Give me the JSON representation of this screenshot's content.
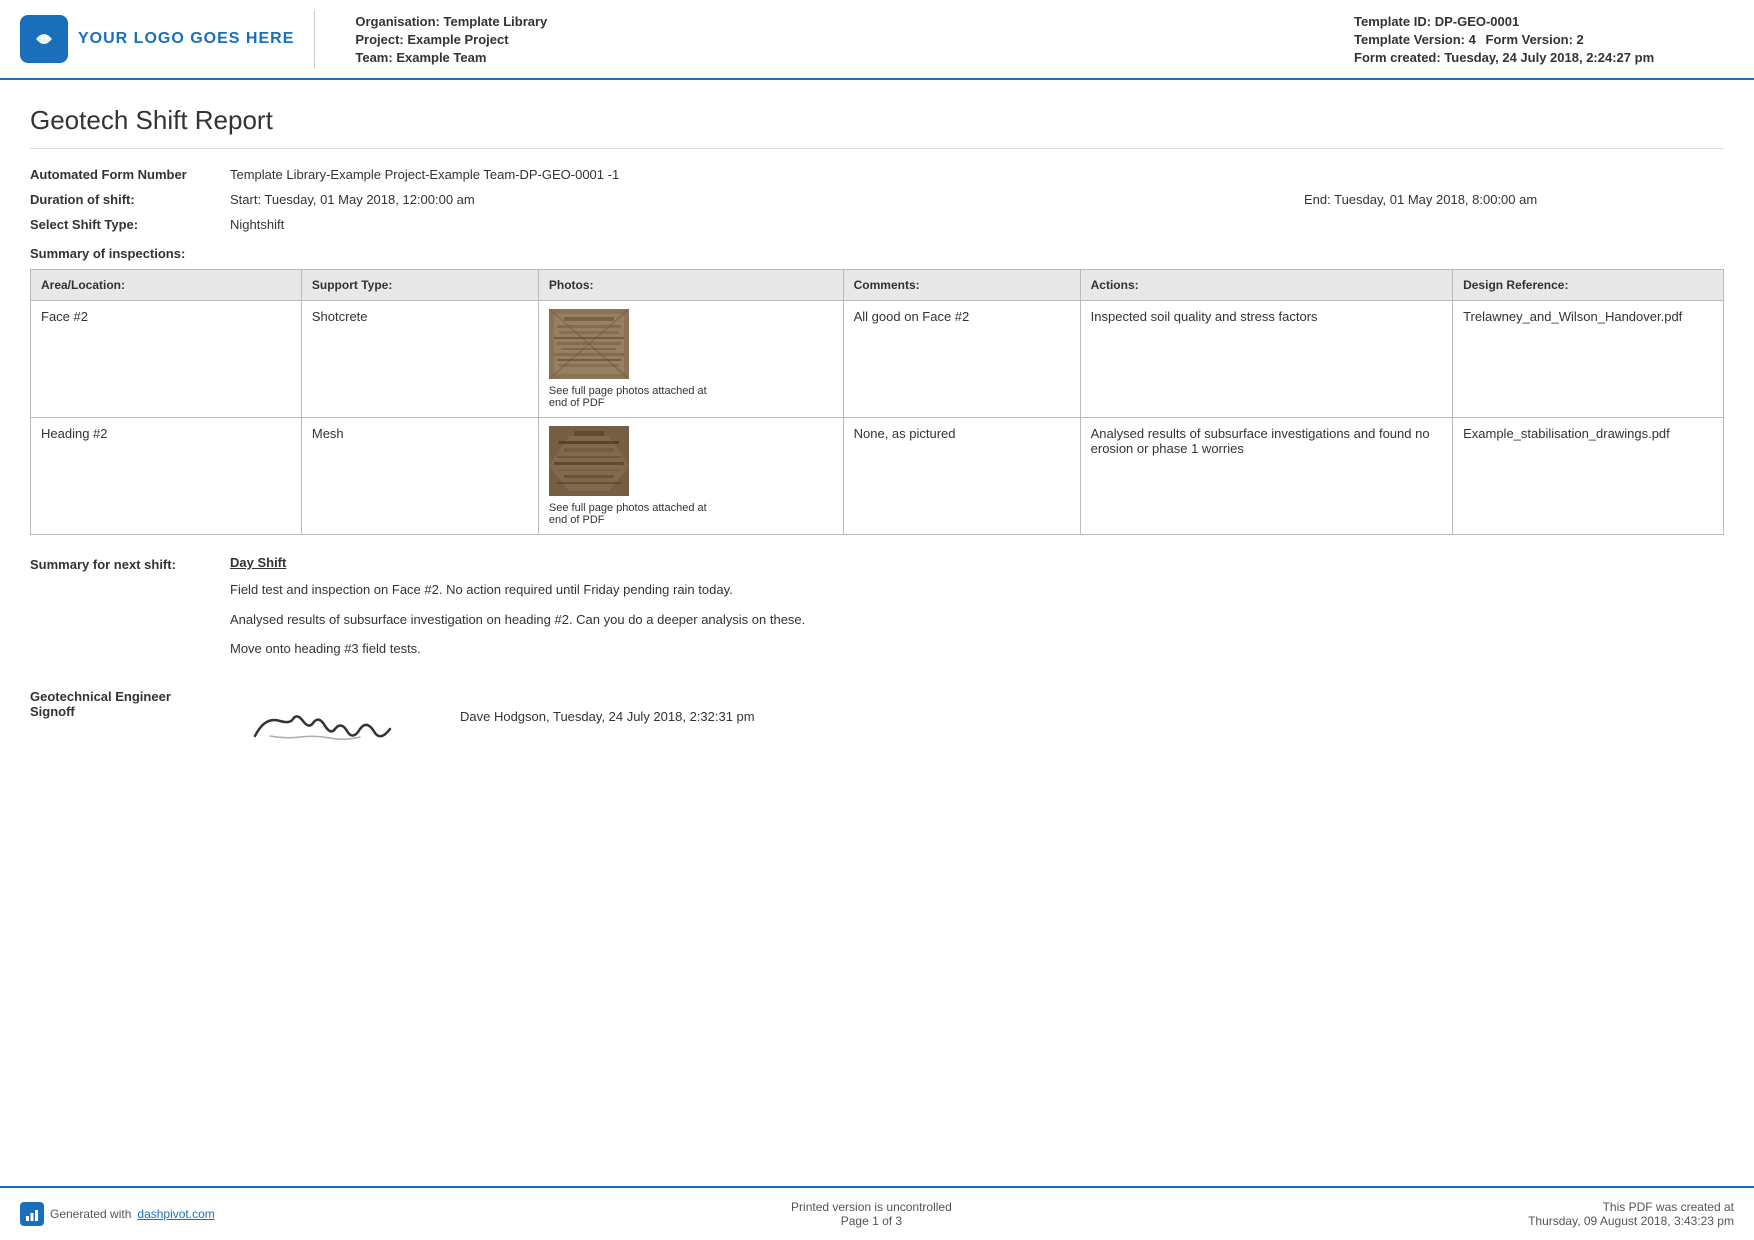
{
  "header": {
    "logo_text": "YOUR LOGO GOES HERE",
    "org_label": "Organisation:",
    "org_value": "Template Library",
    "project_label": "Project:",
    "project_value": "Example Project",
    "team_label": "Team:",
    "team_value": "Example Team",
    "template_id_label": "Template ID:",
    "template_id_value": "DP-GEO-0001",
    "template_version_label": "Template Version:",
    "template_version_value": "4",
    "form_version_label": "Form Version:",
    "form_version_value": "2",
    "form_created_label": "Form created:",
    "form_created_value": "Tuesday, 24 July 2018, 2:24:27 pm"
  },
  "report": {
    "title": "Geotech Shift Report",
    "form_number_label": "Automated Form Number",
    "form_number_value": "Template Library-Example Project-Example Team-DP-GEO-0001   -1",
    "duration_label": "Duration of shift:",
    "duration_start": "Start: Tuesday, 01 May 2018, 12:00:00 am",
    "duration_end": "End: Tuesday, 01 May 2018, 8:00:00 am",
    "shift_type_label": "Select Shift Type:",
    "shift_type_value": "Nightshift",
    "summary_title": "Summary of inspections:"
  },
  "table": {
    "headers": [
      "Area/Location:",
      "Support Type:",
      "Photos:",
      "Comments:",
      "Actions:",
      "Design Reference:"
    ],
    "rows": [
      {
        "area": "Face #2",
        "support_type": "Shotcrete",
        "photo_caption": "See full page photos attached at end of PDF",
        "comments": "All good on Face #2",
        "actions": "Inspected soil quality and stress factors",
        "design_ref": "Trelawney_and_Wilson_Handover.pdf"
      },
      {
        "area": "Heading #2",
        "support_type": "Mesh",
        "photo_caption": "See full page photos attached at end of PDF",
        "comments": "None, as pictured",
        "actions": "Analysed results of subsurface investigations and found no erosion or phase 1 worries",
        "design_ref": "Example_stabilisation_drawings.pdf"
      }
    ]
  },
  "next_shift": {
    "label": "Summary for next shift:",
    "heading": "Day Shift",
    "paragraphs": [
      "Field test and inspection on Face #2. No action required until Friday pending rain today.",
      "Analysed results of subsurface investigation on heading #2. Can you do a deeper analysis on these.",
      "Move onto heading #3 field tests."
    ]
  },
  "signoff": {
    "label": "Geotechnical Engineer Signoff",
    "name_date": "Dave Hodgson, Tuesday, 24 July 2018, 2:32:31 pm"
  },
  "footer": {
    "generated_text": "Generated with",
    "link_text": "dashpivot.com",
    "center_text": "Printed version is uncontrolled",
    "page_text": "Page 1 of 3",
    "right_text": "This PDF was created at",
    "right_date": "Thursday, 09 August 2018, 3:43:23 pm"
  }
}
